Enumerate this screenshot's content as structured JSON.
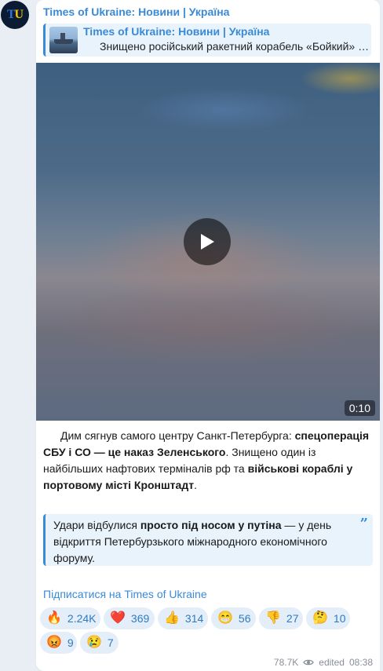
{
  "channel": {
    "avatar_letter_1": "T",
    "avatar_letter_2": "U",
    "name": "Times of Ukraine: Новини | Україна"
  },
  "forward": {
    "title": "Times of Ukraine: Новини | Україна",
    "text": "Знищено російський ракетний корабель «Бойкий» у Петербурзі"
  },
  "video": {
    "duration": "0:10",
    "play_icon": "play-icon"
  },
  "message": {
    "p1": "Дим сягнув самого центру Санкт-Петербурга: ",
    "p1_bold": "спецоперація СБУ і СО — це наказ Зеленського",
    "p2": ". Знищено один із найбільших нафтових терміналів рф та ",
    "p2_bold": "військові кораблі у портовому місті Кронштадт",
    "p3": "."
  },
  "quote": {
    "q1": "Удари відбулися ",
    "q1_bold": "просто під носом у путіна",
    "q2": " — у день відкриття Петербурзького міжнародного економічного форуму."
  },
  "subscribe_link": "Підписатися на Times of Ukraine",
  "reactions": [
    {
      "emoji": "🔥",
      "count": "2.24K"
    },
    {
      "emoji": "❤️",
      "count": "369"
    },
    {
      "emoji": "👍",
      "count": "314"
    },
    {
      "emoji": "😁",
      "count": "56"
    },
    {
      "emoji": "👎",
      "count": "27"
    },
    {
      "emoji": "🤔",
      "count": "10"
    },
    {
      "emoji": "😡",
      "count": "9"
    },
    {
      "emoji": "😢",
      "count": "7"
    }
  ],
  "meta": {
    "views": "78.7K",
    "edited": "edited",
    "time": "08:38"
  },
  "colors": {
    "accent": "#3a8ad6",
    "background": "#e8eef3",
    "bubble": "#ffffff"
  }
}
